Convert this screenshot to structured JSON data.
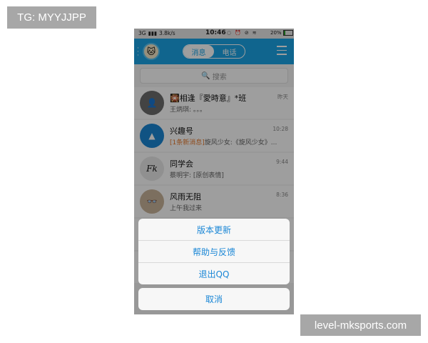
{
  "watermark_tl": "TG: MYYJJPP",
  "watermark_br": "level-mksports.com",
  "status": {
    "signal": "3G",
    "speed": "3.8k/s",
    "time": "10:46",
    "battery": "20%",
    "battery_level": 0.2
  },
  "header": {
    "tab_messages": "消息",
    "tab_phone": "电话"
  },
  "search": {
    "placeholder": "搜索"
  },
  "conversations": [
    {
      "name": "🎇相逢『愛時意』*班",
      "message": "王炳琪: 。。。",
      "time": "昨天",
      "avatar_icon": "person-icon"
    },
    {
      "name": "兴趣号",
      "badge": "[1条新消息]",
      "message": "旋风少女:《旋风少女》...",
      "time": "10:28",
      "avatar_icon": "triangle-logo-icon"
    },
    {
      "name": "同学会",
      "message": "蔡明宇: [原创表情]",
      "time": "9:44",
      "avatar_icon": "fuck-text-icon"
    },
    {
      "name": "风雨无阻",
      "message": "上午我过来",
      "time": "8:36",
      "avatar_icon": "person-icon"
    }
  ],
  "action_sheet": {
    "items": [
      "版本更新",
      "帮助与反馈",
      "退出QQ"
    ],
    "cancel": "取消"
  },
  "colors": {
    "header_blue": "#1aa4e6",
    "action_text_blue": "#1b87d6",
    "highlight_orange": "#e77a2e"
  }
}
